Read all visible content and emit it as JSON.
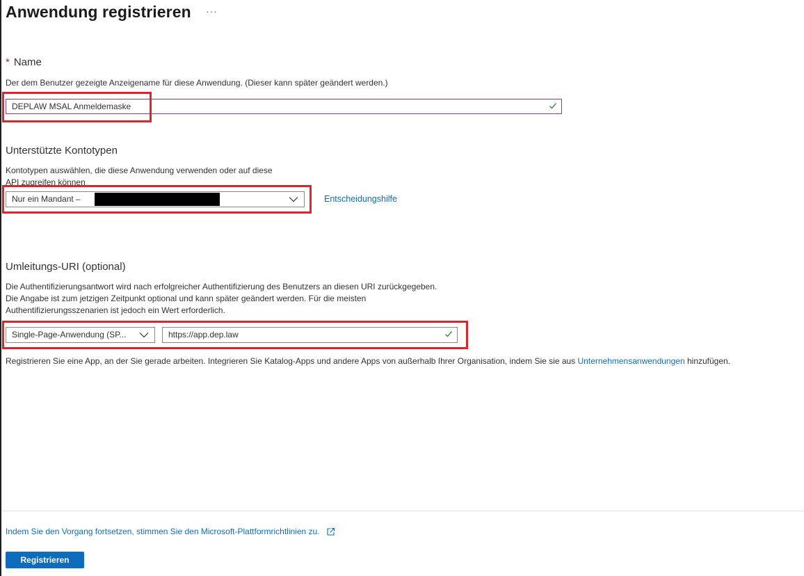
{
  "page": {
    "title": "Anwendung registrieren",
    "more": "···"
  },
  "name_section": {
    "required_mark": "*",
    "title": "Name",
    "description": "Der dem Benutzer gezeigte Anzeigename für diese Anwendung. (Dieser kann später geändert werden.)",
    "value": "DEPLAW MSAL Anmeldemaske"
  },
  "account_section": {
    "title": "Unterstützte Kontotypen",
    "description_line1": "Kontotypen auswählen, die diese Anwendung verwenden oder auf diese",
    "description_line2": "API zugreifen können",
    "select_value": "Nur ein Mandant –",
    "help_link": "Entscheidungshilfe"
  },
  "redirect_section": {
    "title": "Umleitungs-URI (optional)",
    "description_line1": "Die Authentifizierungsantwort wird nach erfolgreicher Authentifizierung des Benutzers an diesen URI zurückgegeben.",
    "description_line2": "Die Angabe ist zum jetzigen Zeitpunkt optional und kann später geändert werden. Für die meisten",
    "description_line3": "Authentifizierungsszenarien ist jedoch ein Wert erforderlich.",
    "platform_value": "Single-Page-Anwendung (SP...",
    "uri_value": "https://app.dep.law"
  },
  "info": {
    "text_before": "Registrieren Sie eine App, an der Sie gerade arbeiten. Integrieren Sie Katalog-Apps und andere Apps von außerhalb Ihrer Organisation, indem Sie sie aus ",
    "link": "Unternehmensanwendungen",
    "text_after": " hinzufügen."
  },
  "footer": {
    "policy_link": "Indem Sie den Vorgang fortsetzen, stimmen Sie den Microsoft-Plattformrichtlinien zu.",
    "register_button": "Registrieren"
  },
  "colors": {
    "accent": "#0f6cbd",
    "highlight": "#d7262e",
    "valid": "#107c10",
    "focus": "#8a3a8a"
  }
}
